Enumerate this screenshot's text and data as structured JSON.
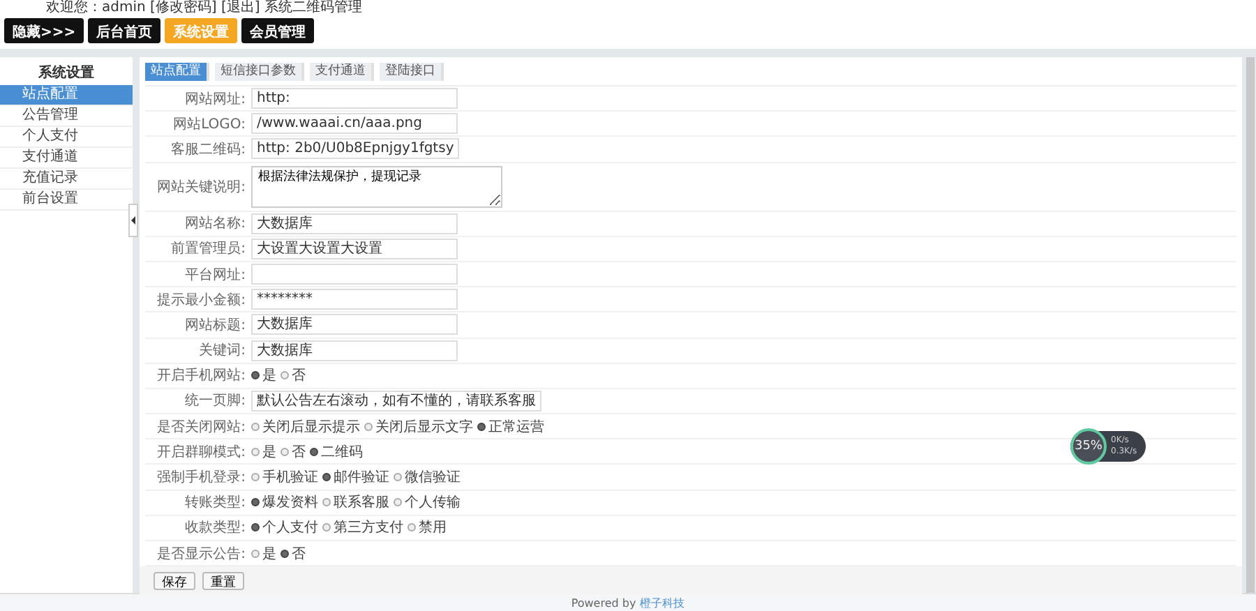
{
  "header": {
    "welcome": "欢迎您：admin [修改密码] [退出] 系统二维码管理",
    "nav": [
      {
        "label": "隐藏>>>",
        "selected": false
      },
      {
        "label": "后台首页",
        "selected": false
      },
      {
        "label": "系统设置",
        "selected": true
      },
      {
        "label": "会员管理",
        "selected": false
      }
    ]
  },
  "sidebar": {
    "title": "系统设置",
    "items": [
      {
        "label": "站点配置",
        "selected": true
      },
      {
        "label": "公告管理",
        "selected": false
      },
      {
        "label": "个人支付",
        "selected": false
      },
      {
        "label": "支付通道",
        "selected": false
      },
      {
        "label": "充值记录",
        "selected": false
      },
      {
        "label": "前台设置",
        "selected": false
      }
    ]
  },
  "tabs": [
    {
      "label": "站点配置",
      "selected": true
    },
    {
      "label": "短信接口参数",
      "selected": false
    },
    {
      "label": "支付通道",
      "selected": false
    },
    {
      "label": "登陆接口",
      "selected": false
    }
  ],
  "fields": [
    {
      "kind": "text",
      "label": "网站网址:",
      "value": "http:"
    },
    {
      "kind": "text",
      "label": "网站LOGO:",
      "value": "/www.waaai.cn/aaa.png"
    },
    {
      "kind": "text",
      "label": "客服二维码:",
      "value": "http:                    2b0/U0b8Epnjgy1fgtsy"
    },
    {
      "kind": "textarea",
      "label": "网站关键说明:",
      "value": "根据法律法规保护，提现记录"
    },
    {
      "kind": "text",
      "label": "网站名称:",
      "value": "大数据库"
    },
    {
      "kind": "text",
      "label": "前置管理员:",
      "value": "大设置大设置大设置"
    },
    {
      "kind": "text",
      "label": "平台网址:"
    },
    {
      "kind": "password",
      "label": "提示最小金额:",
      "value": "********"
    },
    {
      "kind": "text",
      "label": "网站标题:",
      "value": "大数据库"
    },
    {
      "kind": "text",
      "label": "关键词:",
      "value": "大数据库"
    },
    {
      "kind": "radio",
      "label": "开启手机网站:",
      "options": [
        {
          "label": "是",
          "selected": true
        },
        {
          "label": "否",
          "selected": false
        }
      ]
    },
    {
      "kind": "text",
      "label": "统一页脚:",
      "value": "默认公告左右滚动，如有不懂的，请联系客服"
    },
    {
      "kind": "radio",
      "label": "是否关闭网站:",
      "options": [
        {
          "label": "关闭后显示提示",
          "selected": false
        },
        {
          "label": "关闭后显示文字",
          "selected": false
        },
        {
          "label": "正常运营",
          "selected": true
        }
      ]
    },
    {
      "kind": "radio",
      "label": "开启群聊模式:",
      "options": [
        {
          "label": "是",
          "selected": false
        },
        {
          "label": "否",
          "selected": false
        },
        {
          "label": "二维码",
          "selected": true
        }
      ]
    },
    {
      "kind": "radio",
      "label": "强制手机登录:",
      "options": [
        {
          "label": "手机验证",
          "selected": false
        },
        {
          "label": "邮件验证",
          "selected": true
        },
        {
          "label": "微信验证",
          "selected": false
        }
      ]
    },
    {
      "kind": "radio",
      "label": "转账类型:",
      "options": [
        {
          "label": "爆发资料",
          "selected": true
        },
        {
          "label": "联系客服",
          "selected": false
        },
        {
          "label": "个人传输",
          "selected": false
        }
      ]
    },
    {
      "kind": "radio",
      "label": "收款类型:",
      "options": [
        {
          "label": "个人支付",
          "selected": true
        },
        {
          "label": "第三方支付",
          "selected": false
        },
        {
          "label": "禁用",
          "selected": false
        }
      ]
    },
    {
      "kind": "radio",
      "label": "是否显示公告:",
      "options": [
        {
          "label": "是",
          "selected": false
        },
        {
          "label": "否",
          "selected": true
        }
      ]
    }
  ],
  "buttons": [
    "保存",
    "重置"
  ],
  "footer": {
    "text": "Powered by",
    "link": "橙子科技"
  },
  "speed_widget": {
    "percent": "35%",
    "up": "0K/s",
    "down": "0.3K/s"
  }
}
